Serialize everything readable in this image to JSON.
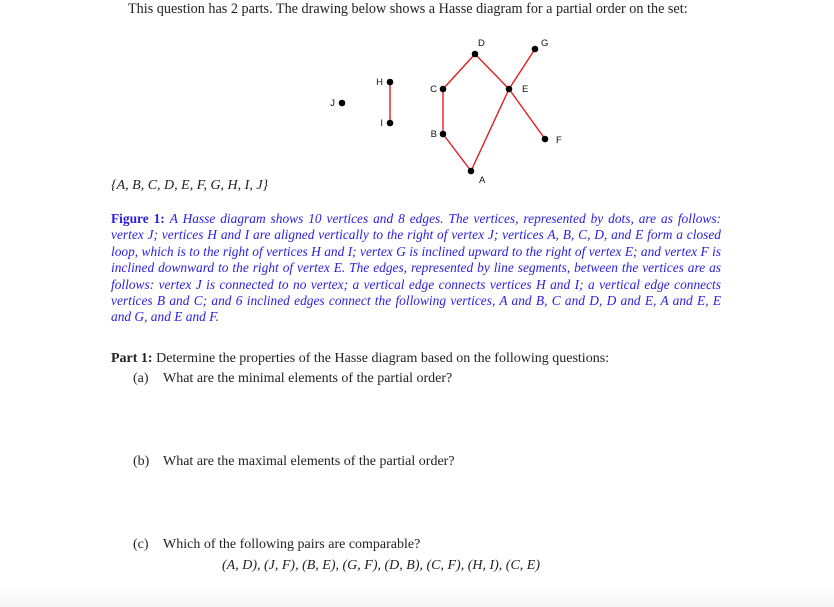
{
  "intro_text": "This question has 2 parts. The drawing below shows a Hasse diagram for a partial order on the set:",
  "diagram": {
    "edge_color": "#e01e1e",
    "vertex_color": "#000000",
    "vertices": [
      {
        "id": "A",
        "label": "A"
      },
      {
        "id": "B",
        "label": "B"
      },
      {
        "id": "C",
        "label": "C"
      },
      {
        "id": "D",
        "label": "D"
      },
      {
        "id": "E",
        "label": "E"
      },
      {
        "id": "F",
        "label": "F"
      },
      {
        "id": "G",
        "label": "G"
      },
      {
        "id": "H",
        "label": "H"
      },
      {
        "id": "I",
        "label": "I"
      },
      {
        "id": "J",
        "label": "J"
      }
    ],
    "edges": [
      [
        "H",
        "I"
      ],
      [
        "B",
        "C"
      ],
      [
        "A",
        "B"
      ],
      [
        "C",
        "D"
      ],
      [
        "D",
        "E"
      ],
      [
        "A",
        "E"
      ],
      [
        "E",
        "G"
      ],
      [
        "E",
        "F"
      ]
    ]
  },
  "set_text": "{A, B, C, D, E, F, G, H, I, J}",
  "figure": {
    "label": "Figure 1:",
    "caption": "A Hasse diagram shows 10 vertices and 8 edges. The vertices, represented by dots, are as follows: vertex J; vertices H and I are aligned vertically to the right of vertex J; vertices A, B, C, D, and E form a closed loop, which is to the right of vertices H and I; vertex G is inclined upward to the right of vertex E; and vertex F is inclined downward to the right of vertex E. The edges, represented by line segments, between the vertices are as follows: vertex J is connected to no vertex; a vertical edge connects vertices H and I; a vertical edge connects vertices B and C; and 6 inclined edges connect the following vertices, A and B, C and D, D and E, A and E, E and G, and E and F.",
    "text_color": "#2a1de0"
  },
  "part1": {
    "label": "Part 1:",
    "text": "Determine the properties of the Hasse diagram based on the following questions:",
    "questions": [
      {
        "tag": "(a)",
        "text": "What are the minimal elements of the partial order?"
      },
      {
        "tag": "(b)",
        "text": "What are the maximal elements of the partial order?"
      },
      {
        "tag": "(c)",
        "text": "Which of the following pairs are comparable?"
      }
    ],
    "pairs_text": "(A, D), (J, F), (B, E), (G, F), (D, B), (C, F), (H, I), (C, E)"
  }
}
